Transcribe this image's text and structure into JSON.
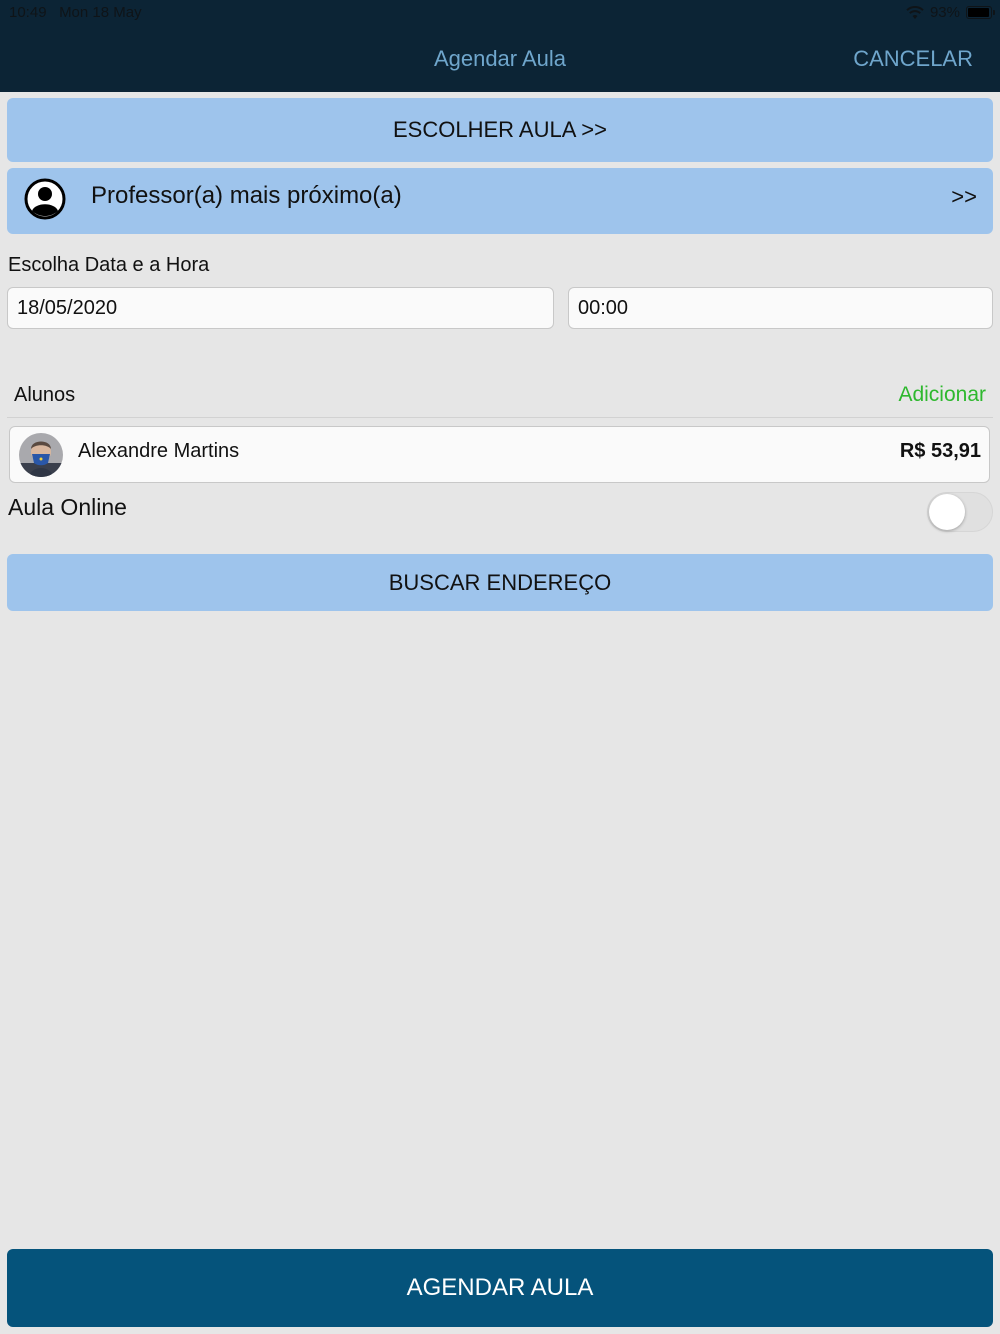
{
  "status_bar": {
    "time": "10:49",
    "date": "Mon 18 May",
    "battery": "93%",
    "battery_level": 0.93,
    "icons": [
      "wifi-icon",
      "battery-icon"
    ]
  },
  "header": {
    "title": "Agendar Aula",
    "cancel_label": "CANCELAR"
  },
  "choose_class": {
    "label": "ESCOLHER AULA >>"
  },
  "professor": {
    "icon": "person-circle-icon",
    "label": "Professor(a) mais próximo(a)",
    "arrow": ">>"
  },
  "schedule": {
    "label": "Escolha Data e a Hora",
    "date_value": "18/05/2020",
    "time_value": "00:00"
  },
  "students": {
    "label": "Alunos",
    "add_label": "Adicionar",
    "items": [
      {
        "name": "Alexandre Martins",
        "price": "R$ 53,91"
      }
    ]
  },
  "online": {
    "label": "Aula Online",
    "enabled": false
  },
  "address_button": {
    "label": "BUSCAR ENDEREÇO"
  },
  "submit_button": {
    "label": "AGENDAR AULA"
  },
  "colors": {
    "header_bg": "#0c2435",
    "header_text": "#6fa6cc",
    "light_button": "#9ec4ec",
    "primary_button": "#05537b",
    "add_link": "#2eb82e",
    "background": "#e6e6e6"
  }
}
